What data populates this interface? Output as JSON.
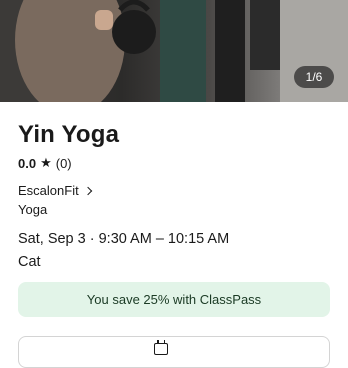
{
  "hero": {
    "image_description_icon": "kettlebell-class-photo",
    "counter": "1/6"
  },
  "class": {
    "title": "Yin Yoga",
    "rating_score": "0.0",
    "rating_icon": "star-icon",
    "rating_count": "(0)",
    "studio": "EscalonFit",
    "category": "Yoga",
    "schedule": "Sat, Sep 3 · 9:30 AM – 10:15 AM",
    "instructor": "Cat"
  },
  "promo": {
    "text": "You save 25% with ClassPass",
    "color": "#e2f4e8"
  },
  "bottom_card": {
    "icon": "calendar-icon"
  }
}
